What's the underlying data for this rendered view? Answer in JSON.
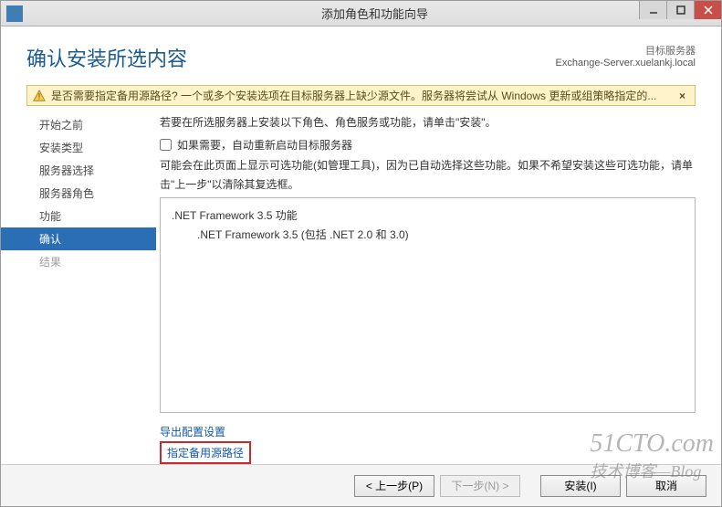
{
  "titlebar": {
    "title": "添加角色和功能向导"
  },
  "header": {
    "title": "确认安装所选内容",
    "dest_label": "目标服务器",
    "dest_value": "Exchange-Server.xuelankj.local"
  },
  "warning": {
    "text": "是否需要指定备用源路径? 一个或多个安装选项在目标服务器上缺少源文件。服务器将尝试从 Windows 更新或组策略指定的...",
    "close": "×"
  },
  "steps": {
    "before": "开始之前",
    "install_type": "安装类型",
    "server_select": "服务器选择",
    "server_roles": "服务器角色",
    "features": "功能",
    "confirm": "确认",
    "results": "结果"
  },
  "content": {
    "line1": "若要在所选服务器上安装以下角色、角色服务或功能，请单击\"安装\"。",
    "checkbox_label": "如果需要，自动重新启动目标服务器",
    "line2": "可能会在此页面上显示可选功能(如管理工具)，因为已自动选择这些功能。如果不希望安装这些可选功能，请单击\"上一步\"以清除其复选框。",
    "feature_parent": ".NET Framework 3.5 功能",
    "feature_child": ".NET Framework 3.5 (包括 .NET 2.0 和 3.0)",
    "export_link": "导出配置设置",
    "alt_source_link": "指定备用源路径"
  },
  "footer": {
    "prev": "< 上一步(P)",
    "next": "下一步(N) >",
    "install": "安装(I)",
    "cancel": "取消"
  },
  "watermark": {
    "en": "51CTO.com",
    "cn": "技术博客—Blog"
  }
}
